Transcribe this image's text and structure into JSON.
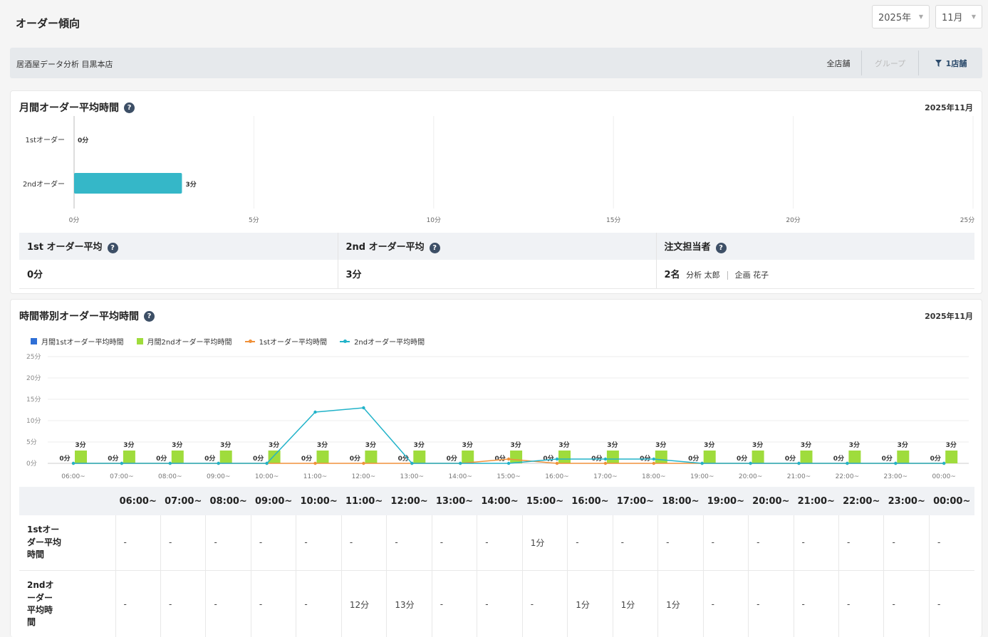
{
  "header": {
    "title": "オーダー傾向",
    "year_select": "2025年",
    "month_select": "11月"
  },
  "store_bar": {
    "store_name": "居酒屋データ分析 目黒本店",
    "segments": [
      "全店舗",
      "グループ",
      "1店舗"
    ]
  },
  "monthly": {
    "title": "月間オーダー平均時間",
    "period": "2025年11月",
    "chart_data": {
      "type": "bar",
      "orientation": "horizontal",
      "categories": [
        "1stオーダー",
        "2ndオーダー"
      ],
      "values": [
        0,
        3
      ],
      "value_labels": [
        "0分",
        "3分"
      ],
      "xlim": [
        0,
        25
      ],
      "x_ticks": [
        "0分",
        "5分",
        "10分",
        "15分",
        "20分",
        "25分"
      ],
      "color": "#35b7c8",
      "grid": true
    },
    "summary": {
      "headers": [
        "1st オーダー平均",
        "2nd オーダー平均",
        "注文担当者"
      ],
      "first_value": "0分",
      "second_value": "3分",
      "staff_count": "2名",
      "staff_names": [
        "分析 太郎",
        "企画 花子"
      ]
    }
  },
  "hourly": {
    "title": "時間帯別オーダー平均時間",
    "period": "2025年11月",
    "legend": [
      "月間1stオーダー平均時間",
      "月間2ndオーダー平均時間",
      "1stオーダー平均時間",
      "2ndオーダー平均時間"
    ],
    "chart_data": {
      "type": "bar+line",
      "categories": [
        "06:00~",
        "07:00~",
        "08:00~",
        "09:00~",
        "10:00~",
        "11:00~",
        "12:00~",
        "13:00~",
        "14:00~",
        "15:00~",
        "16:00~",
        "17:00~",
        "18:00~",
        "19:00~",
        "20:00~",
        "21:00~",
        "22:00~",
        "23:00~",
        "00:00~"
      ],
      "ylim": [
        0,
        25
      ],
      "y_ticks": [
        "0分",
        "5分",
        "10分",
        "15分",
        "20分",
        "25分"
      ],
      "series": [
        {
          "name": "月間1stオーダー平均時間",
          "type": "bar",
          "color": "#2f6fd6",
          "values": [
            0,
            0,
            0,
            0,
            0,
            0,
            0,
            0,
            0,
            0,
            0,
            0,
            0,
            0,
            0,
            0,
            0,
            0,
            0
          ],
          "labels": [
            "0分",
            "0分",
            "0分",
            "0分",
            "0分",
            "0分",
            "0分",
            "0分",
            "0分",
            "0分",
            "0分",
            "0分",
            "0分",
            "0分",
            "0分",
            "0分",
            "0分",
            "0分",
            "0分"
          ]
        },
        {
          "name": "月間2ndオーダー平均時間",
          "type": "bar",
          "color": "#9fdc3c",
          "values": [
            3,
            3,
            3,
            3,
            3,
            3,
            3,
            3,
            3,
            3,
            3,
            3,
            3,
            3,
            3,
            3,
            3,
            3,
            3
          ],
          "labels": [
            "3分",
            "3分",
            "3分",
            "3分",
            "3分",
            "3分",
            "3分",
            "3分",
            "3分",
            "3分",
            "3分",
            "3分",
            "3分",
            "3分",
            "3分",
            "3分",
            "3分",
            "3分",
            "3分"
          ]
        },
        {
          "name": "1stオーダー平均時間",
          "type": "line",
          "color": "#f0913a",
          "values": [
            0,
            0,
            0,
            0,
            0,
            0,
            0,
            0,
            0,
            1,
            0,
            0,
            0,
            0,
            0,
            0,
            0,
            0,
            0
          ]
        },
        {
          "name": "2ndオーダー平均時間",
          "type": "line",
          "color": "#22b3c9",
          "values": [
            0,
            0,
            0,
            0,
            0,
            12,
            13,
            0,
            0,
            0,
            1,
            1,
            1,
            0,
            0,
            0,
            0,
            0,
            0
          ]
        }
      ]
    },
    "table": {
      "hours": [
        "06:00~",
        "07:00~",
        "08:00~",
        "09:00~",
        "10:00~",
        "11:00~",
        "12:00~",
        "13:00~",
        "14:00~",
        "15:00~",
        "16:00~",
        "17:00~",
        "18:00~",
        "19:00~",
        "20:00~",
        "21:00~",
        "22:00~",
        "23:00~",
        "00:00~"
      ],
      "rows": [
        {
          "label": "1stオーダー平均時間",
          "values": [
            "-",
            "-",
            "-",
            "-",
            "-",
            "-",
            "-",
            "-",
            "-",
            "1分",
            "-",
            "-",
            "-",
            "-",
            "-",
            "-",
            "-",
            "-",
            "-"
          ]
        },
        {
          "label": "2ndオーダー平均時間",
          "values": [
            "-",
            "-",
            "-",
            "-",
            "-",
            "12分",
            "13分",
            "-",
            "-",
            "-",
            "1分",
            "1分",
            "1分",
            "-",
            "-",
            "-",
            "-",
            "-",
            "-"
          ]
        }
      ]
    }
  }
}
